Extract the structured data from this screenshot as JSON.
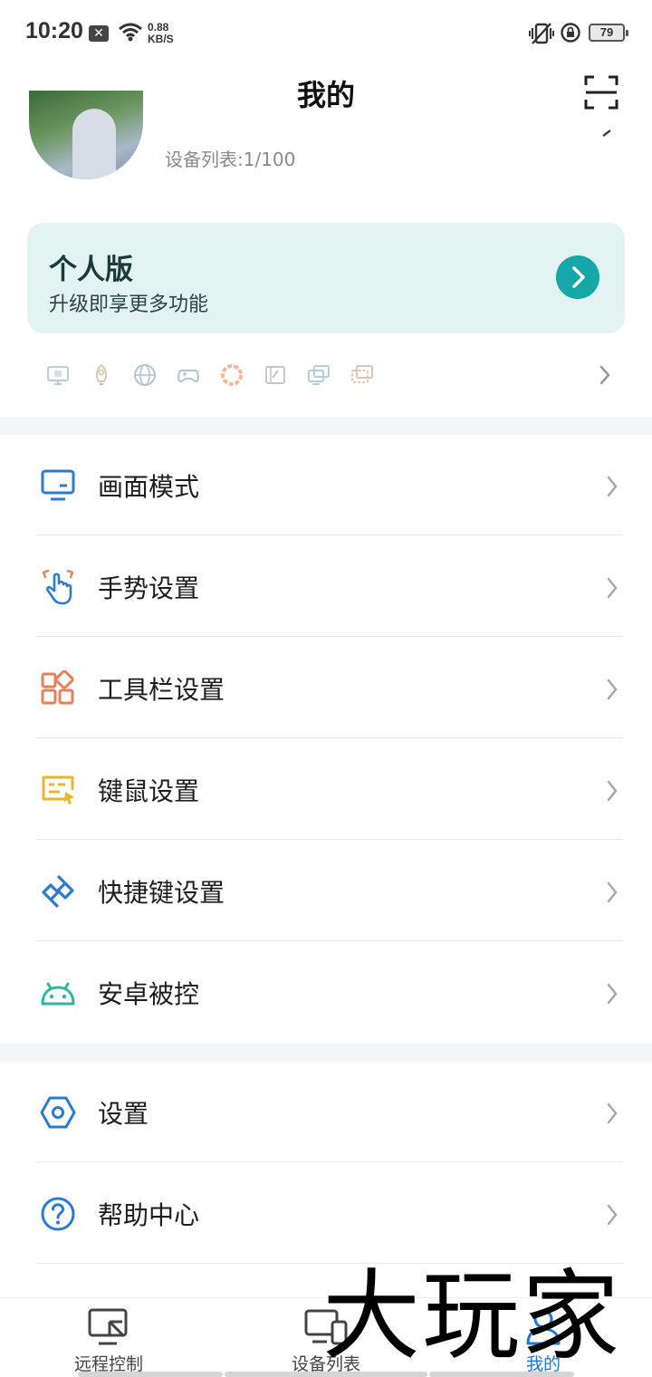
{
  "status_bar": {
    "time": "10:20",
    "notif_badge": "✕",
    "speed_value": "0.88",
    "speed_unit": "KB/S",
    "battery": "79"
  },
  "header": {
    "title": "我的"
  },
  "profile": {
    "device_count": "设备列表:1/100"
  },
  "version_card": {
    "title": "个人版",
    "subtitle": "升级即享更多功能"
  },
  "feature_icons": [
    "monitor-icon",
    "rocket-icon",
    "globe-icon",
    "gamepad-icon",
    "color-wheel-icon",
    "tablet-pen-icon",
    "multi-screen-icon",
    "virtual-screen-icon"
  ],
  "menu_group_1": [
    {
      "label": "画面模式",
      "icon": "display-icon",
      "color": "#2a7bd4"
    },
    {
      "label": "手势设置",
      "icon": "gesture-icon",
      "color": "#2a7bd4"
    },
    {
      "label": "工具栏设置",
      "icon": "grid-icon",
      "color": "#e8805a"
    },
    {
      "label": "键鼠设置",
      "icon": "keyboard-mouse-icon",
      "color": "#e8b82a"
    },
    {
      "label": "快捷键设置",
      "icon": "shortcut-icon",
      "color": "#2a7bd4"
    },
    {
      "label": "安卓被控",
      "icon": "android-icon",
      "color": "#2fb7a6"
    }
  ],
  "menu_group_2": [
    {
      "label": "设置",
      "icon": "settings-hex-icon",
      "color": "#2a7bd4"
    },
    {
      "label": "帮助中心",
      "icon": "help-icon",
      "color": "#2a7bd4"
    }
  ],
  "bottom_nav": [
    {
      "label": "远程控制",
      "icon": "remote-control-icon"
    },
    {
      "label": "设备列表",
      "icon": "device-list-icon"
    },
    {
      "label": "我的",
      "icon": "profile-icon",
      "active": true
    }
  ],
  "watermark": "大玩家",
  "colors": {
    "accent": "#16a7a9",
    "card_bg": "#e2f3f2",
    "active_nav": "#1e78d6"
  }
}
